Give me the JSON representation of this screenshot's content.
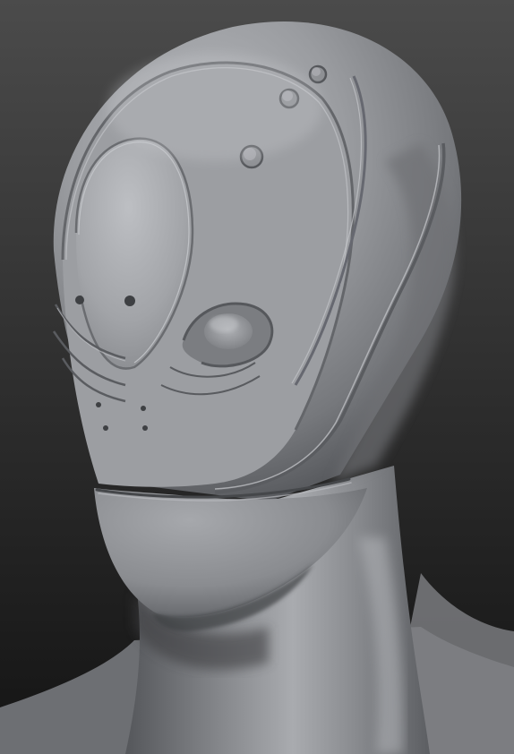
{
  "scene": {
    "subject": "alien-head-sculpt",
    "colors": {
      "background_top": "#4a4a4a",
      "background_bottom": "#151515",
      "clay_light": "#b3b5b9",
      "clay_mid": "#8c8e92",
      "clay_dark": "#55575b",
      "shadow": "#2a2b2d",
      "groove_dark": "#5d5f63",
      "groove_light": "#c6c8cc"
    }
  }
}
